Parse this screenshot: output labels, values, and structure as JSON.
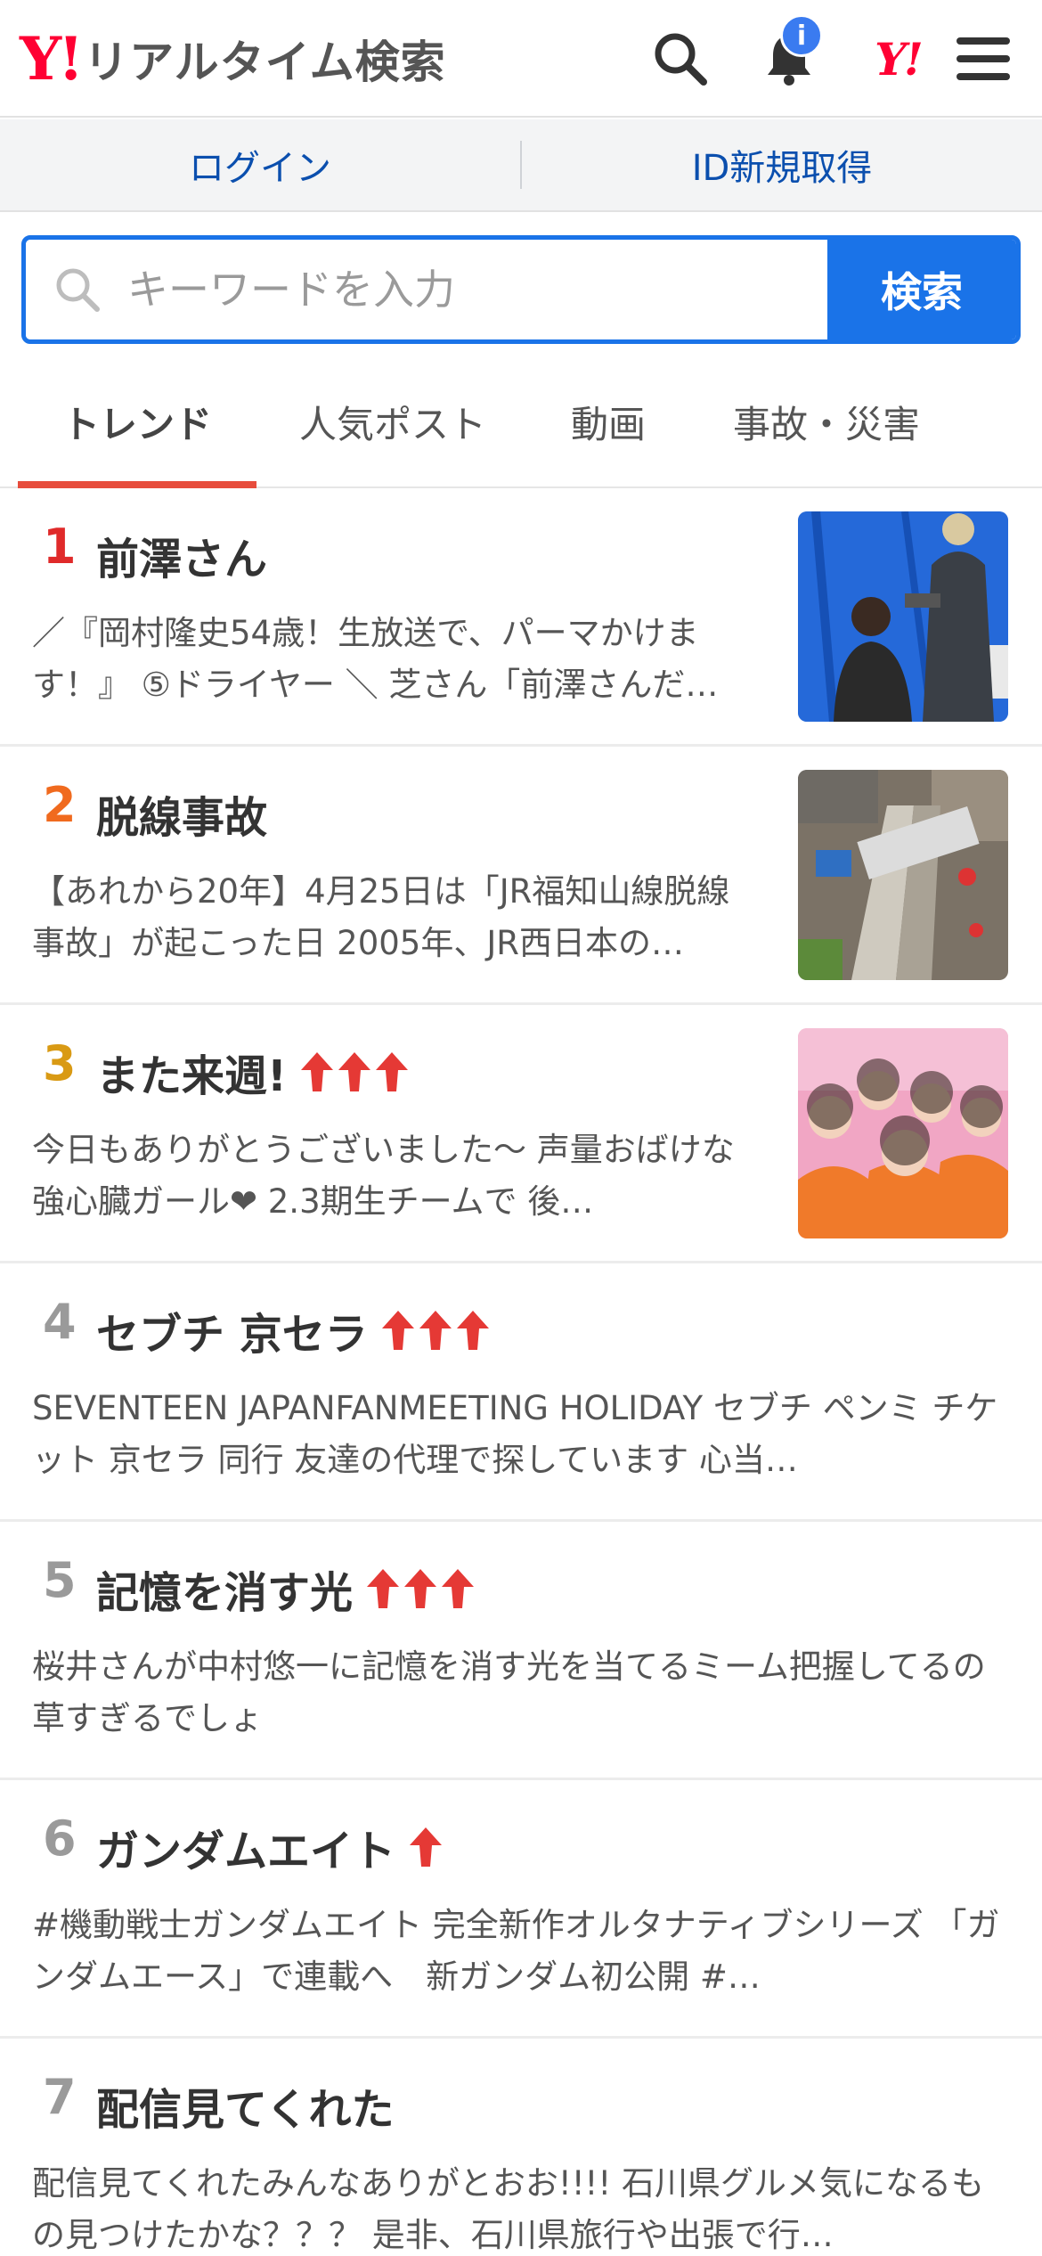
{
  "header": {
    "logo_mark": "Y!",
    "title": "リアルタイム検索",
    "notification_badge": "i",
    "yahoo_small_logo": "Y!",
    "icons": [
      "search-icon",
      "bell-icon",
      "yahoo-logo",
      "hamburger-menu-icon"
    ]
  },
  "loginbar": {
    "login_label": "ログイン",
    "register_label": "ID新規取得"
  },
  "search": {
    "placeholder": "キーワードを入力",
    "button_label": "検索"
  },
  "tabs": [
    {
      "label": "トレンド",
      "active": true
    },
    {
      "label": "人気ポスト",
      "active": false
    },
    {
      "label": "動画",
      "active": false
    },
    {
      "label": "事故・災害",
      "active": false
    }
  ],
  "colors": {
    "accent_blue": "#1a73e8",
    "link_blue": "#0b4fae",
    "tab_underline": "#e74c3c",
    "rank1": "#e02a2a",
    "rank2": "#f06a1e",
    "rank3": "#d99a14",
    "rank_other": "#9a9a9a",
    "arrow_red": "#e53935"
  },
  "trends": [
    {
      "rank": "1",
      "title": "前澤さん",
      "arrows": 0,
      "has_image": true,
      "image": "photo-hairdresser",
      "desc": "／『岡村隆史54歳！生放送で、パーマかけます！』 ⑤ドライヤー ＼ 芝さん「前澤さんだ…"
    },
    {
      "rank": "2",
      "title": "脱線事故",
      "arrows": 0,
      "has_image": true,
      "image": "photo-derailment",
      "desc": "【あれから20年】4月25日は「JR福知山線脱線事故」が起こった日 2005年、JR西日本の…"
    },
    {
      "rank": "3",
      "title": "また来週!",
      "arrows": 3,
      "has_image": true,
      "image": "photo-group",
      "desc": "今日もありがとうございました〜󠄀󠄀 声量おばけな強心臓ガール󠄀❤󠄀 2.3期生チームで󠄀 後…"
    },
    {
      "rank": "4",
      "title": "セブチ 京セラ",
      "arrows": 3,
      "has_image": false,
      "desc": "SEVENTEEN JAPANFANMEETING HOLIDAY セブチ ペンミ チケット 京セラ 同行 󠄀󠄀友達の代理で探しています 心当…"
    },
    {
      "rank": "5",
      "title": "記憶を消す光",
      "arrows": 3,
      "has_image": false,
      "desc": "桜井さんが中村悠一に記憶を消す光を当てるミーム把握してるの草すぎるでしょ"
    },
    {
      "rank": "6",
      "title": "ガンダムエイト",
      "arrows": 1,
      "has_image": false,
      "desc": "󠄀#機動戦士ガンダムエイト󠄀 完全新作オルタナティブシリーズ 「ガンダムエース」で連載へ　新ガンダム初公開 #…"
    },
    {
      "rank": "7",
      "title": "配信見てくれた",
      "arrows": 0,
      "has_image": false,
      "desc": "配信見てくれたみんなありがとおお!!!! 石川県グルメ気になるもの見つけたかな？？？ 是非、石川県旅行や出張で行…"
    }
  ]
}
